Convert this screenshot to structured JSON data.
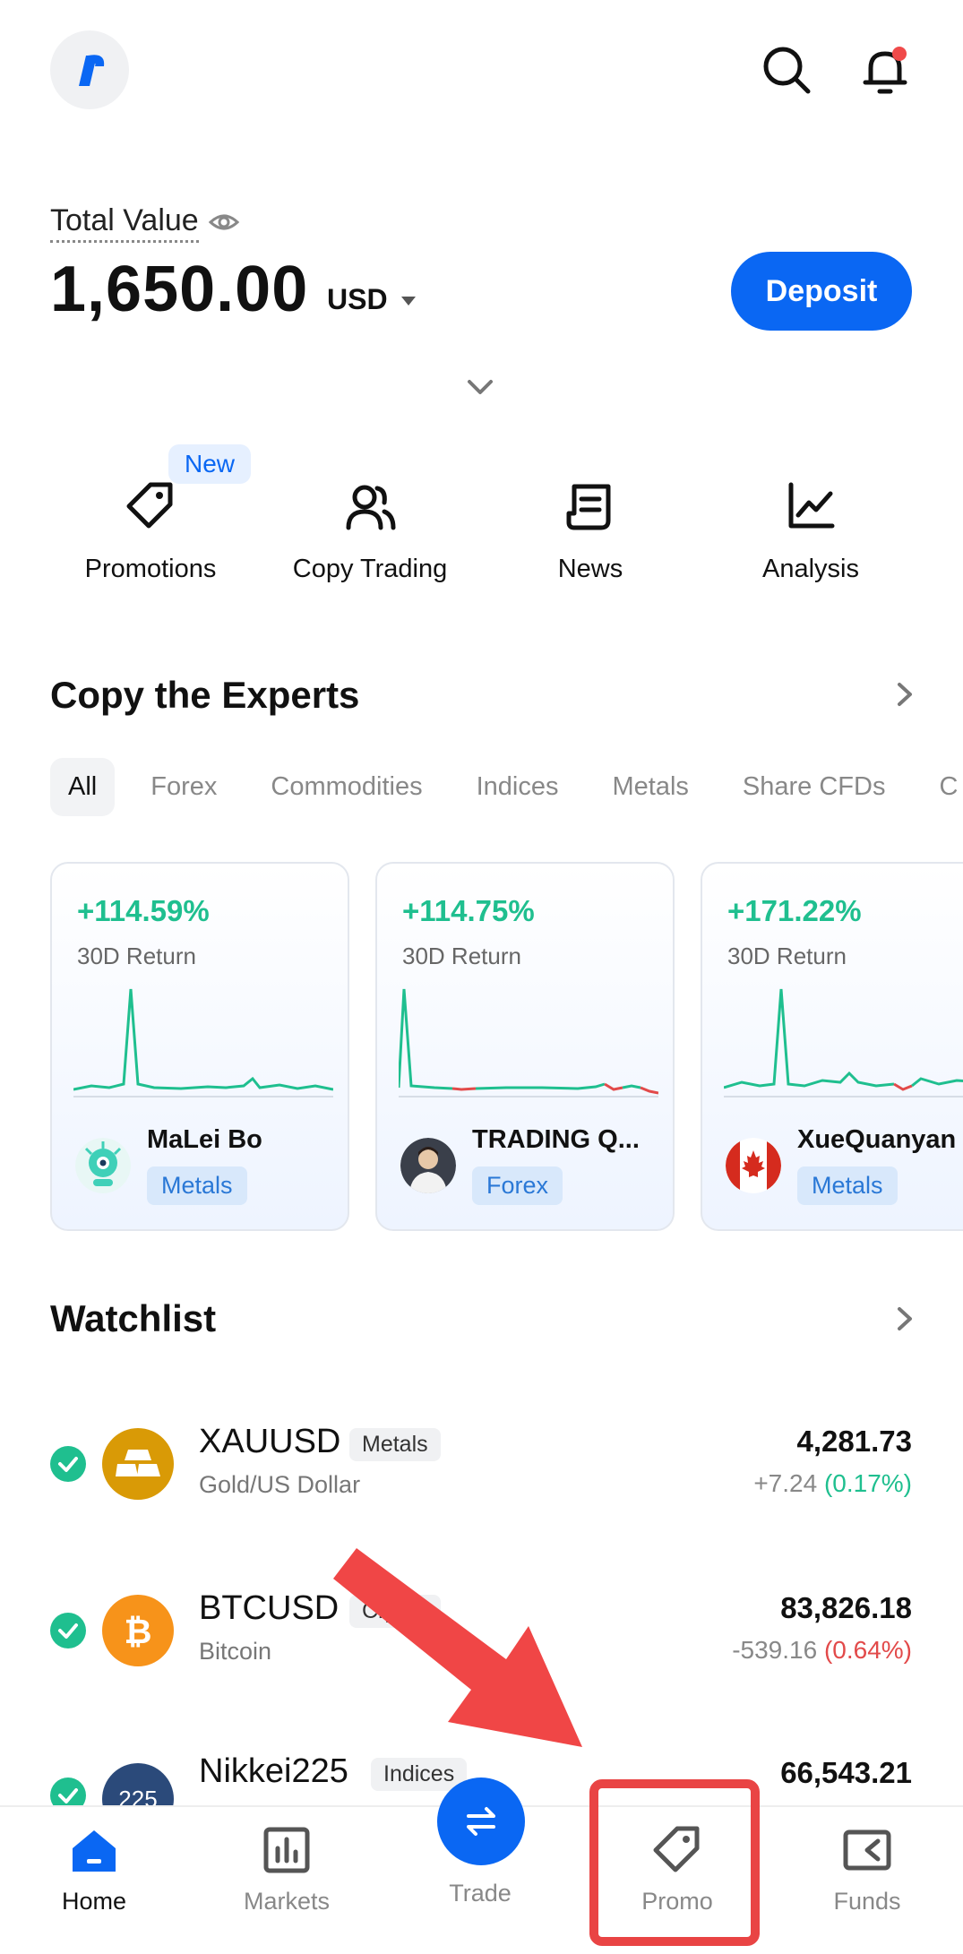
{
  "header": {
    "logo_alt": "app-logo",
    "search_icon": "search-icon",
    "bell_icon": "bell-icon",
    "colors": {
      "accent": "#0a67f3",
      "notify_dot": "#f04a4a"
    }
  },
  "balance": {
    "label": "Total Value",
    "amount": "1,650.00",
    "currency": "USD",
    "deposit_label": "Deposit"
  },
  "quick_actions": [
    {
      "label": "Promotions",
      "icon": "tag-icon",
      "badge": "New"
    },
    {
      "label": "Copy Trading",
      "icon": "users-icon"
    },
    {
      "label": "News",
      "icon": "news-icon"
    },
    {
      "label": "Analysis",
      "icon": "chart-icon"
    }
  ],
  "experts": {
    "title": "Copy the Experts",
    "tabs": [
      "All",
      "Forex",
      "Commodities",
      "Indices",
      "Metals",
      "Share CFDs",
      "C"
    ],
    "active_tab": "All",
    "cards": [
      {
        "return": "+114.59%",
        "return_label": "30D Return",
        "name": "MaLei Bo",
        "category": "Metals"
      },
      {
        "return": "+114.75%",
        "return_label": "30D Return",
        "name": "TRADING Q...",
        "category": "Forex"
      },
      {
        "return": "+171.22%",
        "return_label": "30D Return",
        "name": "XueQuanyan",
        "category": "Metals"
      }
    ]
  },
  "watchlist": {
    "title": "Watchlist",
    "items": [
      {
        "symbol": "XAUUSD",
        "tag": "Metals",
        "name": "Gold/US Dollar",
        "price": "4,281.73",
        "change": "+7.24",
        "change_pct": "(0.17%)",
        "direction": "up"
      },
      {
        "symbol": "BTCUSD",
        "tag": "Crypto",
        "name": "Bitcoin",
        "price": "83,826.18",
        "change": "-539.16",
        "change_pct": "(0.64%)",
        "direction": "down"
      },
      {
        "symbol": "Nikkei225",
        "tag": "Indices",
        "logo_text": "225",
        "price": "66,543.21"
      }
    ]
  },
  "bottom_nav": [
    {
      "label": "Home",
      "icon": "home-icon",
      "active": true
    },
    {
      "label": "Markets",
      "icon": "bar-chart-icon"
    },
    {
      "label": "Trade",
      "icon": "swap-icon"
    },
    {
      "label": "Promo",
      "icon": "tag-icon"
    },
    {
      "label": "Funds",
      "icon": "wallet-icon"
    }
  ]
}
